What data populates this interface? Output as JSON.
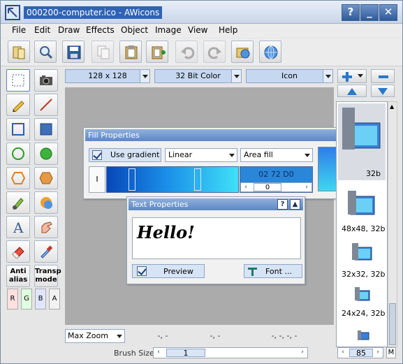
{
  "window": {
    "title": "000200-computer.ico - AWicons",
    "buttons": [
      "?",
      "_",
      "✕"
    ]
  },
  "menu": [
    "File",
    "Edit",
    "Draw",
    "Effects",
    "Object",
    "Image",
    "View",
    "Help"
  ],
  "toolbar": {
    "icons": [
      "open-icon",
      "zoom-icon",
      "save-icon",
      "copy-icon",
      "paste-icon",
      "paste-new-icon",
      "undo-icon",
      "redo-icon",
      "folder-globe-icon",
      "web-icon"
    ]
  },
  "params": {
    "size": "128 x 128",
    "color_depth": "32 Bit Color",
    "format": "Icon"
  },
  "tools": {
    "antialias": [
      "Anti",
      "alias"
    ],
    "transp": [
      "Transp",
      "mode"
    ],
    "channels": [
      "R",
      "G",
      "B",
      "A"
    ],
    "channel_colors": [
      "#ffe0e0",
      "#e0ffe0",
      "#e0e6ff",
      "#f2f2f2"
    ]
  },
  "fill_panel": {
    "title": "Fill Properties",
    "use_gradient": "Use gradient",
    "gradient_type": "Linear",
    "fill_area": "Area fill",
    "color_value": "02 72 D0",
    "position": "0",
    "left_marker": "I"
  },
  "text_panel": {
    "title": "Text Properties",
    "sample": "Hello!",
    "preview": "Preview",
    "font": "Font ..."
  },
  "status": {
    "zoom": "Max Zoom",
    "coord1": "-, -",
    "coord2": "-, -",
    "coord3": "-, -, -, -"
  },
  "brush": {
    "label": "Brush Size",
    "value": "1"
  },
  "formats": [
    {
      "label": "48x48, 32b"
    },
    {
      "label": "32x32, 32b"
    },
    {
      "label": "24x24, 32b"
    }
  ],
  "first_format": {
    "label": "32b"
  },
  "preview_size": "85",
  "preview_m": "M"
}
